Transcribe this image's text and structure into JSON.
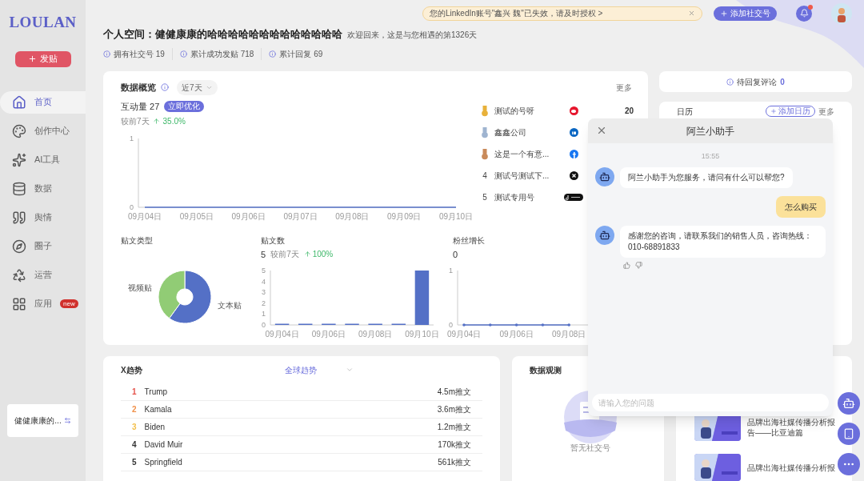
{
  "sidebar": {
    "logo": "LOULAN",
    "post_button": "发贴",
    "items": [
      {
        "label": "首页",
        "selected": true
      },
      {
        "label": "创作中心",
        "selected": false
      },
      {
        "label": "AI工具",
        "selected": false
      },
      {
        "label": "数据",
        "selected": false
      },
      {
        "label": "舆情",
        "selected": false
      },
      {
        "label": "圈子",
        "selected": false
      },
      {
        "label": "运营",
        "selected": false
      },
      {
        "label": "应用",
        "selected": false,
        "badge": "new"
      }
    ],
    "account": "健健康康的..."
  },
  "top_bar": {
    "notice": "您的LinkedIn账号\"鑫兴 魏\"已失效，请及时授权 >",
    "add_button": "添加社交号",
    "notification_dot": true
  },
  "header": {
    "title": "个人空间：健健康康的哈哈哈哈哈哈哈哈哈哈哈哈哈",
    "welcome": "欢迎回来，这是与您相遇的第1326天",
    "stats": [
      "拥有社交号 19",
      "累计成功发贴 718",
      "累计回复 69"
    ]
  },
  "overview": {
    "title": "数据概览",
    "period": "近7天",
    "more": "更多",
    "metric_label": "互动量",
    "metric_value": "27",
    "optimize_button": "立即优化",
    "compare_label": "较前7天",
    "change": "35.0%",
    "chart_data": {
      "type": "line",
      "categories": [
        "09月04日",
        "09月05日",
        "09月06日",
        "09月07日",
        "09月08日",
        "09月09日",
        "09月10日"
      ],
      "series": [
        {
          "color": "#5470c6",
          "values": [
            0,
            0,
            0,
            0,
            0,
            0,
            0
          ]
        }
      ],
      "ylim": [
        0,
        1
      ],
      "yticks": [
        0,
        1
      ]
    },
    "ranking": [
      {
        "kind": "medal",
        "color": "#e8b13a",
        "name": "测试的号呀",
        "value": "20"
      },
      {
        "kind": "medal",
        "color": "#9fb4d0",
        "name": "鑫鑫公司"
      },
      {
        "kind": "medal",
        "color": "#c98a5a",
        "name": "这是一个有意..."
      },
      {
        "kind": "number",
        "rank": "4",
        "name": "测试号测试下..."
      },
      {
        "kind": "number",
        "rank": "5",
        "name": "测试专用号"
      }
    ]
  },
  "post_types": {
    "title": "贴文类型",
    "chart_data": {
      "type": "donut",
      "categories": [
        "文本贴",
        "视频贴"
      ],
      "series": [
        {
          "values": [
            60,
            40
          ]
        }
      ]
    }
  },
  "posts": {
    "title": "贴文数",
    "value": "5",
    "compare_label": "较前7天",
    "change": "100%",
    "chart_data": {
      "type": "bar",
      "categories": [
        "09月04日",
        null,
        "09月06日",
        null,
        "09月08日",
        null,
        "09月10日"
      ],
      "series": [
        {
          "color": "#5470c6",
          "values": [
            0,
            0,
            0,
            0,
            0,
            0,
            5
          ]
        }
      ],
      "ylim": [
        0,
        5
      ],
      "yticks": [
        0,
        1,
        2,
        3,
        4,
        5
      ]
    }
  },
  "fans": {
    "title": "粉丝增长",
    "value": "0",
    "chart_data": {
      "type": "line",
      "categories": [
        "09月04日",
        null,
        "09月06日",
        null,
        "09月08日"
      ],
      "series": [
        {
          "color": "#5470c6",
          "values": [
            0,
            0,
            0,
            0,
            0
          ]
        }
      ],
      "ylim": [
        0,
        1
      ],
      "yticks": [
        0,
        1
      ]
    }
  },
  "pending_comments": {
    "label": "待回复评论",
    "count": "0"
  },
  "calendar": {
    "title": "日历",
    "add_button": "添加日历",
    "more": "更多"
  },
  "x_trends": {
    "title": "X趋势",
    "region": "全球趋势",
    "rows": [
      {
        "rank": "1",
        "color": "#e5534b",
        "topic": "Trump",
        "count": "4.5m推文"
      },
      {
        "rank": "2",
        "color": "#f0904a",
        "topic": "Kamala",
        "count": "3.6m推文"
      },
      {
        "rank": "3",
        "color": "#f3c04d",
        "topic": "Biden",
        "count": "1.2m推文"
      },
      {
        "rank": "4",
        "color": "#333333",
        "topic": "David Muir",
        "count": "170k推文"
      },
      {
        "rank": "5",
        "color": "#333333",
        "topic": "Springfield",
        "count": "561k推文"
      }
    ]
  },
  "observation": {
    "title": "数据观测",
    "empty_text": "暂无社交号"
  },
  "reports": [
    {
      "title": "品牌出海社媒传播分析报告——比亚迪篇"
    },
    {
      "title": "品牌出海社媒传播分析报"
    }
  ],
  "chat": {
    "title": "阿兰小助手",
    "time": "15:55",
    "messages": [
      {
        "kind": "bot",
        "text": "阿兰小助手为您服务，请问有什么可以帮您?",
        "feedback": false
      },
      {
        "kind": "user",
        "text": "怎么购买"
      },
      {
        "kind": "bot",
        "text": "感谢您的咨询，请联系我们的销售人员，咨询热线：010-68891833",
        "feedback": true
      }
    ],
    "placeholder": "请输入您的问题"
  }
}
